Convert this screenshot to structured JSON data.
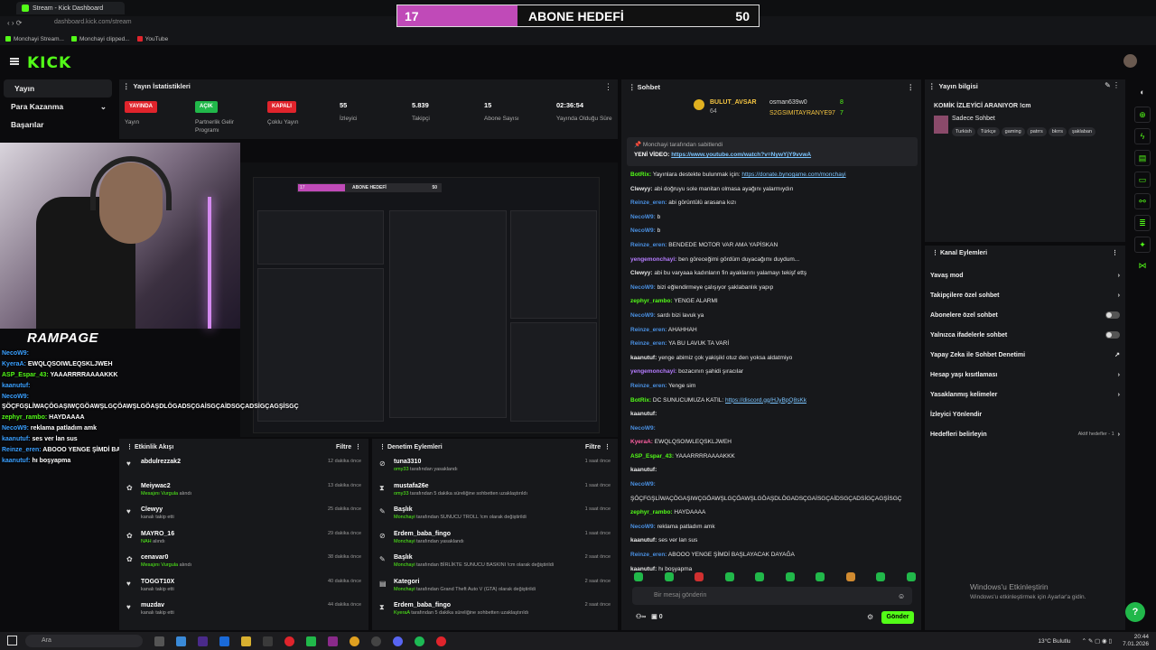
{
  "browser": {
    "tab_title": "Stream - Kick Dashboard",
    "url": "dashboard.kick.com/stream",
    "bookmarks": [
      "Monchayi Stream...",
      "Monchayi clipped...",
      "YouTube"
    ]
  },
  "goal": {
    "current": "17",
    "title": "ABONE HEDEFİ",
    "target": "50",
    "progress": 0.34,
    "color": "#c04ab8"
  },
  "brand": {
    "logo": "KICK",
    "accent": "#53fc18"
  },
  "sidebar": {
    "items": [
      {
        "label": "Yayın",
        "active": true
      },
      {
        "label": "Para Kazanma"
      },
      {
        "label": "Başarılar"
      }
    ]
  },
  "stats": {
    "title": "Yayın İstatistikleri",
    "items": [
      {
        "value": "YAYINDA",
        "label": "Yayın",
        "color": "#e0242c"
      },
      {
        "value": "AÇIK",
        "label": "Partnerlik Gelir Programı",
        "color": "#21b84a"
      },
      {
        "value": "KAPALI",
        "label": "Çoklu Yayın",
        "color": "#e0242c"
      },
      {
        "value": "55",
        "label": "İzleyici"
      },
      {
        "value": "5.839",
        "label": "Takipçi"
      },
      {
        "value": "15",
        "label": "Abone Sayısı"
      },
      {
        "value": "02:36:54",
        "label": "Yayında Olduğu Süre"
      }
    ]
  },
  "overlay": {
    "brand": "RAMPAGE",
    "mini_goal_current": "17",
    "mini_goal_title": "ABONE HEDEFİ",
    "mini_goal_target": "50",
    "chat": [
      {
        "user": "NecoW9:",
        "text": ""
      },
      {
        "user": "KyeraA:",
        "text": "EWQLQSOIWLEQSKLJWEH"
      },
      {
        "user": "ASP_Espar_43:",
        "text": "YAAARRRRAAAAKKK"
      },
      {
        "user": "kaanutuf:",
        "text": ""
      },
      {
        "user": "NecoW9:",
        "text": "ŞÖÇFGŞLİWAÇÖGAŞIWÇGÖAWŞLGÇÖAWŞLGÖAŞDLÖGADSÇGAİSGÇAİDSGÇADSİGÇAGŞİSGÇ"
      },
      {
        "user": "zephyr_rambo:",
        "text": "HAYDAAAA"
      },
      {
        "user": "NecoW9:",
        "text": "reklama patladım amk"
      },
      {
        "user": "kaanutuf:",
        "text": "ses ver lan sus"
      },
      {
        "user": "Reinze_eren:",
        "text": "ABOOO YENGE ŞİMDİ BAŞLAYACAK DAYAĞA"
      },
      {
        "user": "kaanutuf:",
        "text": "hı boşyapma"
      }
    ]
  },
  "activity": {
    "title": "Etkinlik Akışı",
    "filter": "Filtre",
    "rows": [
      {
        "icon": "heart-icon",
        "name": "abdulrezzak2",
        "sub": "",
        "time": "12 dakika önce"
      },
      {
        "icon": "gift-icon",
        "name": "Meiywac2",
        "sub_hl": "Mesajını Vurgula",
        "sub": " alındı",
        "time": "13 dakika önce"
      },
      {
        "icon": "heart-icon",
        "name": "Clewyy",
        "sub": "kanalı takip etti",
        "time": "25 dakika önce"
      },
      {
        "icon": "gift-icon",
        "name": "MAYRO_16",
        "sub_hl": "NAH",
        "sub": " alındı",
        "time": "29 dakika önce"
      },
      {
        "icon": "gift-icon",
        "name": "cenavar0",
        "sub_hl": "Mesajını Vurgula",
        "sub": " alındı",
        "time": "38 dakika önce"
      },
      {
        "icon": "heart-icon",
        "name": "TOGGT10X",
        "sub": "kanalı takip etti",
        "time": "40 dakika önce"
      },
      {
        "icon": "heart-icon",
        "name": "muzdav",
        "sub": "kanalı takip etti",
        "time": "44 dakika önce"
      }
    ]
  },
  "modactions": {
    "title": "Denetim Eylemleri",
    "filter": "Filtre",
    "rows": [
      {
        "icon": "ban-icon",
        "name": "tuna3310",
        "sub_hl": "omy33",
        "sub": " tarafından yasaklandı",
        "time": "1 saat önce"
      },
      {
        "icon": "hourglass-icon",
        "name": "mustafa26e",
        "sub_hl": "omy33",
        "sub": " tarafından 5 dakika süreliğine sohbetten uzaklaştırıldı",
        "time": "1 saat önce"
      },
      {
        "icon": "edit-icon",
        "name": "Başlık",
        "sub_hl": "Monchayi",
        "sub": " tarafından SUNUCU TROLL !cm olarak değiştirildi",
        "time": "1 saat önce"
      },
      {
        "icon": "ban-icon",
        "name": "Erdem_baba_fingo",
        "sub_hl": "Monchayi",
        "sub": " tarafından yasaklandı",
        "time": "1 saat önce"
      },
      {
        "icon": "edit-icon",
        "name": "Başlık",
        "sub_hl": "Monchayi",
        "sub": " tarafından BİRLİKTE SUNUCU BASKINI !cm olarak değiştirildi",
        "time": "2 saat önce"
      },
      {
        "icon": "folder-icon",
        "name": "Kategori",
        "sub_hl": "Monchayi",
        "sub": " tarafından Grand Theft Auto V (GTA) olarak değiştirildi",
        "time": "2 saat önce"
      },
      {
        "icon": "hourglass-icon",
        "name": "Erdem_baba_fingo",
        "sub_hl": "KyeraA",
        "sub": " tarafından 5 dakika süreliğine sohbetten uzaklaştırıldı",
        "time": "2 saat önce"
      }
    ]
  },
  "chat": {
    "title": "Sohbet",
    "gifters": [
      {
        "name": "BULUT_AVSAR",
        "count": "64"
      },
      {
        "name": "osman639w0",
        "count": "8"
      },
      {
        "name": "S2GSIMITAYRANYE97",
        "count": "7"
      }
    ],
    "pinned_label": "Monchayi tarafından sabitlendi",
    "pinned_prefix": "YENİ VİDEO: ",
    "pinned_link": "https://www.youtube.com/watch?v=NywYjY9vvwA",
    "messages": [
      {
        "user": "BotRix:",
        "color": "c-green",
        "text": "Yayınlara destekte bulunmak için: ",
        "link": "https://donate.bynogame.com/monchayi"
      },
      {
        "user": "Clewyy:",
        "color": "c-white",
        "text": "abi doğruyu sole manitan olmasa ayağını yalarmıydın"
      },
      {
        "user": "Reinze_eren:",
        "color": "c-blue",
        "text": "abi görüntülü arasana kızı"
      },
      {
        "user": "NecoW9:",
        "color": "c-blue",
        "text": "b"
      },
      {
        "user": "NecoW9:",
        "color": "c-blue",
        "text": "b"
      },
      {
        "user": "Reinze_eren:",
        "color": "c-blue",
        "text": "BENDEDE MOTOR VAR AMA YAPİSKAN"
      },
      {
        "user": "yengemonchayi:",
        "color": "c-purple",
        "text": "ben göreceğimi gördüm duyacağımı duydum..."
      },
      {
        "user": "Clewyy:",
        "color": "c-white",
        "text": "abi bu varyaaa kadınların fin ayaklarını yalamayı tekişf ettş"
      },
      {
        "user": "NecoW9:",
        "color": "c-blue",
        "text": "bizi eğlendirmeye çalışıyor şaklabanlık yapıp"
      },
      {
        "user": "zephyr_rambo:",
        "color": "c-green",
        "text": "YENGE ALARMI"
      },
      {
        "user": "NecoW9:",
        "color": "c-blue",
        "text": "sardı bizi lavuk ya"
      },
      {
        "user": "Reinze_eren:",
        "color": "c-blue",
        "text": "AHAHHAH"
      },
      {
        "user": "Reinze_eren:",
        "color": "c-blue",
        "text": "YA BU LAVUK TA VARİ"
      },
      {
        "user": "kaanutuf:",
        "color": "c-white",
        "text": "yenge abimiz çok yakişikl otuz den yoksa aldatmiyo"
      },
      {
        "user": "yengemonchayi:",
        "color": "c-purple",
        "text": "bozacının şahidi şıracılar"
      },
      {
        "user": "Reinze_eren:",
        "color": "c-blue",
        "text": "Yenge sim"
      },
      {
        "user": "BotRix:",
        "color": "c-green",
        "text": "DC SUNUCUMUZA KATIL: ",
        "link": "https://discord.gg/HJyBpQ8sKk"
      },
      {
        "user": "kaanutuf:",
        "color": "c-white",
        "text": ""
      },
      {
        "user": "NecoW9:",
        "color": "c-blue",
        "text": ""
      },
      {
        "user": "KyeraA:",
        "color": "c-pink",
        "text": "EWQLQSOIWLEQSKLJWEH"
      },
      {
        "user": "ASP_Espar_43:",
        "color": "c-green",
        "text": "YAAARRRRAAAAKKK"
      },
      {
        "user": "kaanutuf:",
        "color": "c-white",
        "text": ""
      },
      {
        "user": "NecoW9:",
        "color": "c-blue",
        "text": ""
      },
      {
        "user": "",
        "color": "c-white",
        "text": "ŞÖÇFGŞLİWAÇÖGAŞIWÇGÖAWŞLGÇÖAWŞLGÖAŞDLÖGADSÇGAİSGÇAİDSGÇADSİGÇAGŞİSGÇ"
      },
      {
        "user": "zephyr_rambo:",
        "color": "c-green",
        "text": "HAYDAAAA"
      },
      {
        "user": "NecoW9:",
        "color": "c-blue",
        "text": "reklama patladım amk"
      },
      {
        "user": "kaanutuf:",
        "color": "c-white",
        "text": "ses ver lan sus"
      },
      {
        "user": "Reinze_eren:",
        "color": "c-blue",
        "text": "ABOOO YENGE ŞİMDİ BAŞLAYACAK DAYAĞA"
      },
      {
        "user": "kaanutuf:",
        "color": "c-white",
        "text": "hı boşyapma"
      }
    ],
    "input_placeholder": "Bir mesaj gönderin",
    "send_label": "Gönder",
    "footer_count": "0"
  },
  "streaminfo": {
    "title": "Yayın bilgisi",
    "stream_title": "KOMİK İZLEYİCİ ARANIYOR !cm",
    "mode": "Sadece Sohbet",
    "tags": [
      "Turkish",
      "Türkçe",
      "gaming",
      "patrrs",
      "bkrrs",
      "şaklaban"
    ]
  },
  "chanactions": {
    "title": "Kanal Eylemleri",
    "rows": [
      {
        "label": "Yavaş mod",
        "control": "chevron"
      },
      {
        "label": "Takipçilere özel sohbet",
        "control": "chevron"
      },
      {
        "label": "Abonelere özel sohbet",
        "control": "toggle"
      },
      {
        "label": "Yalnızca ifadelerle sohbet",
        "control": "toggle"
      },
      {
        "label": "Yapay Zeka ile Sohbet Denetimi",
        "control": "external"
      },
      {
        "label": "Hesap yaşı kısıtlaması",
        "control": "chevron"
      },
      {
        "label": "Yasaklanmış kelimeler",
        "control": "chevron"
      },
      {
        "label": "İzleyici Yönlendir",
        "control": "none"
      },
      {
        "label": "Hedefleri belirleyin",
        "control": "chevron",
        "extra": "Aktif hedefler - 1"
      }
    ]
  },
  "windows": {
    "activate_title": "Windows'u Etkinleştirin",
    "activate_sub": "Windows'u etkinleştirmek için Ayarlar'a gidin.",
    "search": "Ara",
    "weather": "13°C  Bulutlu",
    "time": "20:44",
    "date": "7.01.2026"
  }
}
